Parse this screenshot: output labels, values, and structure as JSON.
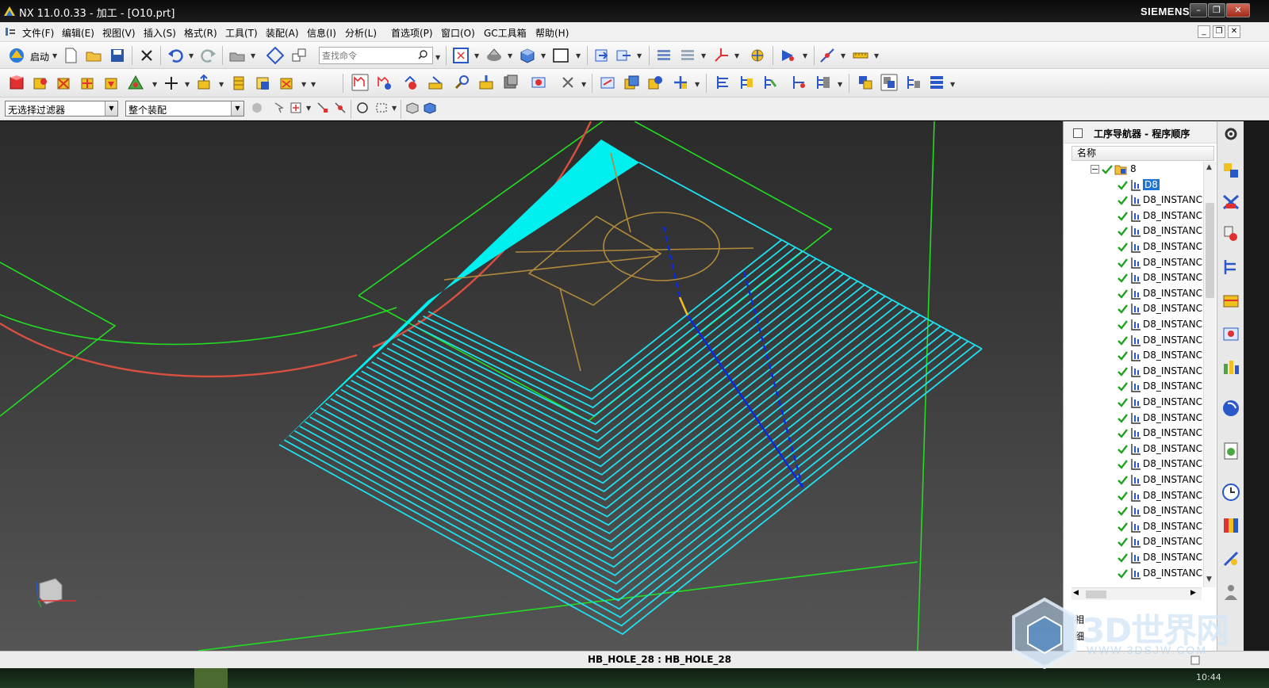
{
  "window": {
    "title": "NX 11.0.0.33 - 加工 - [O10.prt]",
    "brand": "SIEMENS"
  },
  "menu": {
    "items": [
      "文件(F)",
      "编辑(E)",
      "视图(V)",
      "插入(S)",
      "格式(R)",
      "工具(T)",
      "装配(A)",
      "信息(I)",
      "分析(L)",
      "首选项(P)",
      "窗口(O)",
      "GC工具箱",
      "帮助(H)"
    ]
  },
  "toolbar": {
    "start_label": "启动",
    "search_placeholder": "查找命令"
  },
  "selection_bar": {
    "filter_value": "无选择过滤器",
    "scope_value": "整个装配"
  },
  "navigator": {
    "title": "工序导航器 - 程序顺序",
    "column_header": "名称",
    "root_label": "8",
    "rows": [
      "D8",
      "D8_INSTANC",
      "D8_INSTANC",
      "D8_INSTANC",
      "D8_INSTANC",
      "D8_INSTANC",
      "D8_INSTANC",
      "D8_INSTANC",
      "D8_INSTANC",
      "D8_INSTANC",
      "D8_INSTANC",
      "D8_INSTANC",
      "D8_INSTANC",
      "D8_INSTANC",
      "D8_INSTANC",
      "D8_INSTANC",
      "D8_INSTANC",
      "D8_INSTANC",
      "D8_INSTANC",
      "D8_INSTANC",
      "D8_INSTANC",
      "D8_INSTANC",
      "D8_INSTANC",
      "D8_INSTANC",
      "D8_INSTANC",
      "D8_INSTANC"
    ],
    "selected_index": 0,
    "bottom_labels": [
      "相",
      "细"
    ]
  },
  "status": {
    "text": "HB_HOLE_28 : HB_HOLE_28",
    "clock": "10:44"
  },
  "watermark": {
    "text": "3D世界网",
    "url": "WWW.3DSJW.COM"
  },
  "colors": {
    "toolpath": "#1ee0f0",
    "boundary": "#22dd22",
    "curve": "#d85040",
    "geometry": "#b08a3a",
    "tool_axis": "#0a2ae0",
    "selection": "#1e74d6"
  }
}
